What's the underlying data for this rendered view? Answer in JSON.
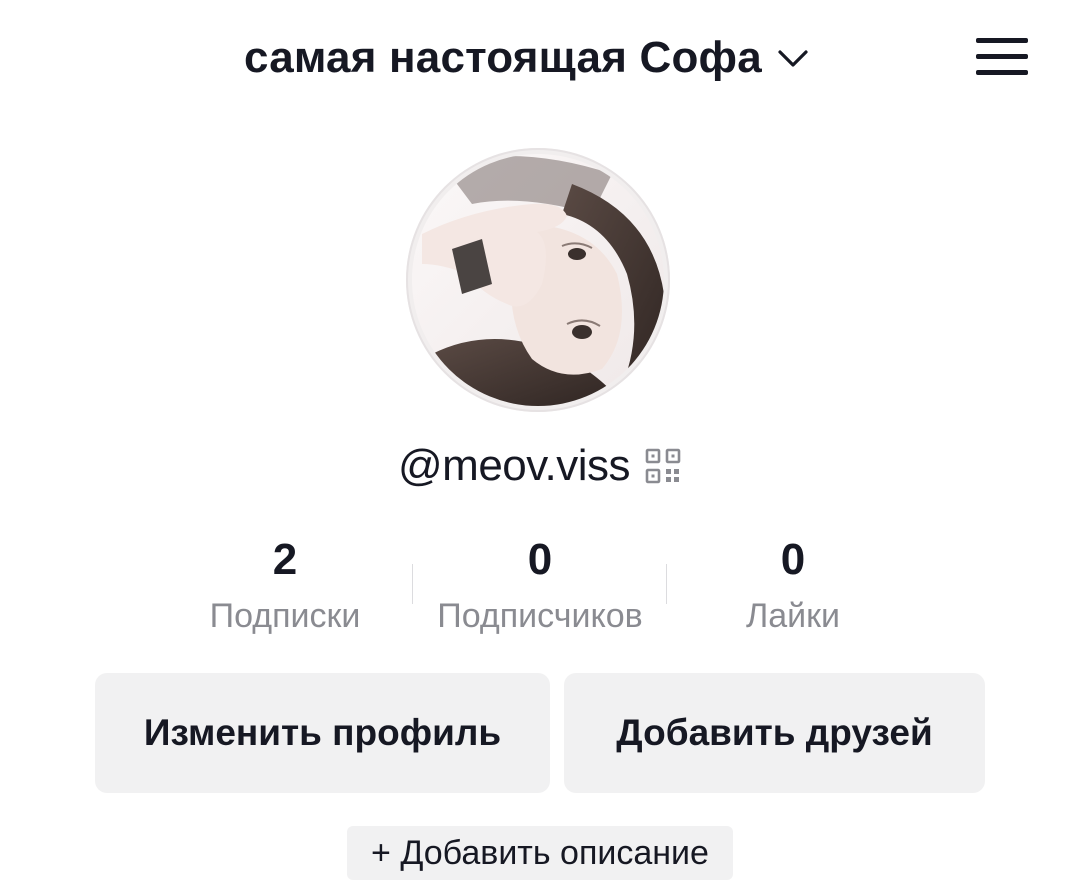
{
  "header": {
    "account_name": "самая настоящая Софа",
    "chevron_icon": "chevron-down-icon",
    "menu_icon": "hamburger-menu-icon"
  },
  "profile": {
    "avatar_alt": "avatar",
    "username": "@meov.viss",
    "qr_icon": "qr-code-icon"
  },
  "stats": [
    {
      "value": "2",
      "label": "Подписки"
    },
    {
      "value": "0",
      "label": "Подписчиков"
    },
    {
      "value": "0",
      "label": "Лайки"
    }
  ],
  "actions": {
    "edit_profile": "Изменить профиль",
    "add_friends": "Добавить друзей",
    "add_description": "+ Добавить описание"
  },
  "colors": {
    "text": "#161823",
    "secondary_text": "#8a8b91",
    "button_bg": "#f1f1f2"
  }
}
